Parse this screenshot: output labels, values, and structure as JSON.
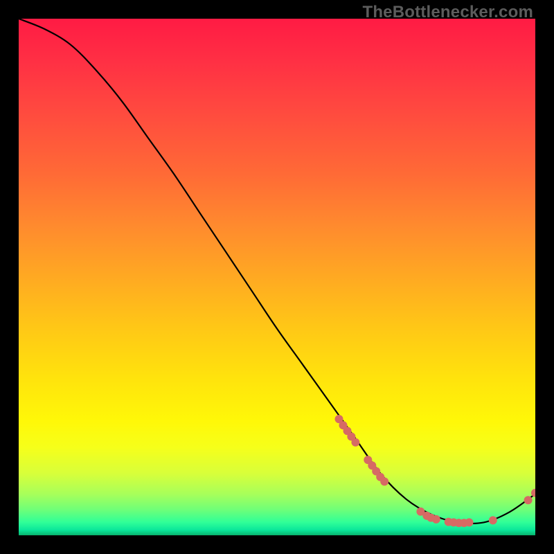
{
  "watermark": "TheBottlenecker.com",
  "chart_data": {
    "type": "line",
    "title": "",
    "xlabel": "",
    "ylabel": "",
    "xlim": [
      0,
      100
    ],
    "ylim": [
      0,
      100
    ],
    "grid": false,
    "series": [
      {
        "name": "curve",
        "x": [
          0,
          5,
          10,
          15,
          20,
          25,
          30,
          35,
          40,
          45,
          50,
          55,
          60,
          65,
          70,
          75,
          80,
          85,
          90,
          95,
          100
        ],
        "y": [
          100,
          98,
          95,
          90,
          84,
          77,
          70,
          62.5,
          55,
          47.5,
          40,
          33,
          26,
          19,
          12,
          7,
          4,
          2.5,
          2.5,
          4.5,
          8
        ]
      }
    ],
    "markers": {
      "name": "dots",
      "color": "#d66a64",
      "radius": 6,
      "points": [
        {
          "x": 62.0,
          "y": 22.5
        },
        {
          "x": 62.8,
          "y": 21.3
        },
        {
          "x": 63.6,
          "y": 20.2
        },
        {
          "x": 64.4,
          "y": 19.1
        },
        {
          "x": 65.2,
          "y": 18.0
        },
        {
          "x": 67.6,
          "y": 14.6
        },
        {
          "x": 68.4,
          "y": 13.5
        },
        {
          "x": 69.2,
          "y": 12.4
        },
        {
          "x": 70.0,
          "y": 11.3
        },
        {
          "x": 70.8,
          "y": 10.4
        },
        {
          "x": 77.8,
          "y": 4.6
        },
        {
          "x": 79.0,
          "y": 3.8
        },
        {
          "x": 79.8,
          "y": 3.4
        },
        {
          "x": 80.8,
          "y": 3.1
        },
        {
          "x": 83.2,
          "y": 2.6
        },
        {
          "x": 84.2,
          "y": 2.5
        },
        {
          "x": 85.2,
          "y": 2.4
        },
        {
          "x": 86.2,
          "y": 2.4
        },
        {
          "x": 87.2,
          "y": 2.5
        },
        {
          "x": 91.8,
          "y": 2.9
        },
        {
          "x": 98.6,
          "y": 6.8
        },
        {
          "x": 100.0,
          "y": 8.2
        }
      ]
    }
  }
}
